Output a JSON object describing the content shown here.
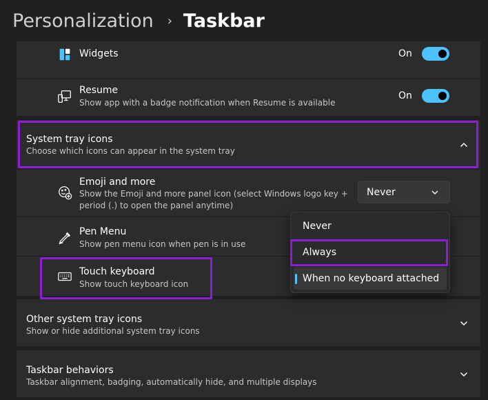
{
  "breadcrumb": {
    "parent": "Personalization",
    "separator": "›",
    "current": "Taskbar"
  },
  "widgets": {
    "title": "Widgets",
    "state": "On",
    "icon": "widgets-icon"
  },
  "resume": {
    "title": "Resume",
    "description": "Show app with a badge notification when Resume is available",
    "state": "On",
    "icon": "resume-icon"
  },
  "system_tray": {
    "title": "System tray icons",
    "description": "Choose which icons can appear in the system tray",
    "expanded": true,
    "items": {
      "emoji": {
        "title": "Emoji and more",
        "description_line1": "Show the Emoji and more panel icon (select Windows logo key +",
        "description_line2": "period (.) to open the panel anytime)",
        "selected_value": "Never",
        "icon": "emoji-icon"
      },
      "pen": {
        "title": "Pen Menu",
        "description": "Show pen menu icon when pen is in use",
        "icon": "pen-icon"
      },
      "touch_keyboard": {
        "title": "Touch keyboard",
        "description": "Show touch keyboard icon",
        "icon": "keyboard-icon"
      }
    }
  },
  "dropdown_menu": {
    "options": [
      "Never",
      "Always",
      "When no keyboard attached"
    ],
    "selected_index": 2
  },
  "other_tray": {
    "title": "Other system tray icons",
    "description": "Show or hide additional system tray icons"
  },
  "taskbar_behaviors": {
    "title": "Taskbar behaviors",
    "description": "Taskbar alignment, badging, automatically hide, and multiple displays"
  },
  "colors": {
    "accent": "#4cc2ff",
    "highlight": "#8a1fd6",
    "background": "#202020",
    "card": "#2c2c2c"
  }
}
